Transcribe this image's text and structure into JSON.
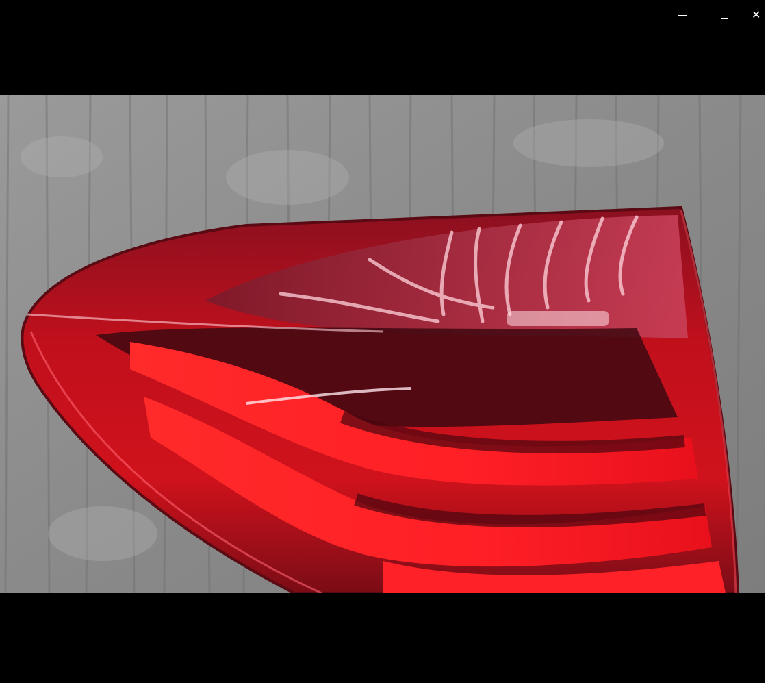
{
  "window": {
    "controls": [
      {
        "name": "minimize",
        "icon": "minimize-icon"
      },
      {
        "name": "maximize",
        "icon": "maximize-icon"
      },
      {
        "name": "close",
        "icon": "close-icon"
      }
    ]
  },
  "video": {
    "subject": "red-led-tail-light-on-concrete",
    "colors": {
      "background": "#000000",
      "concrete": "#8f8f8f",
      "lens_red": "#e0101a",
      "lens_dark": "#5a0a12",
      "highlight": "#ffd4dc"
    }
  }
}
